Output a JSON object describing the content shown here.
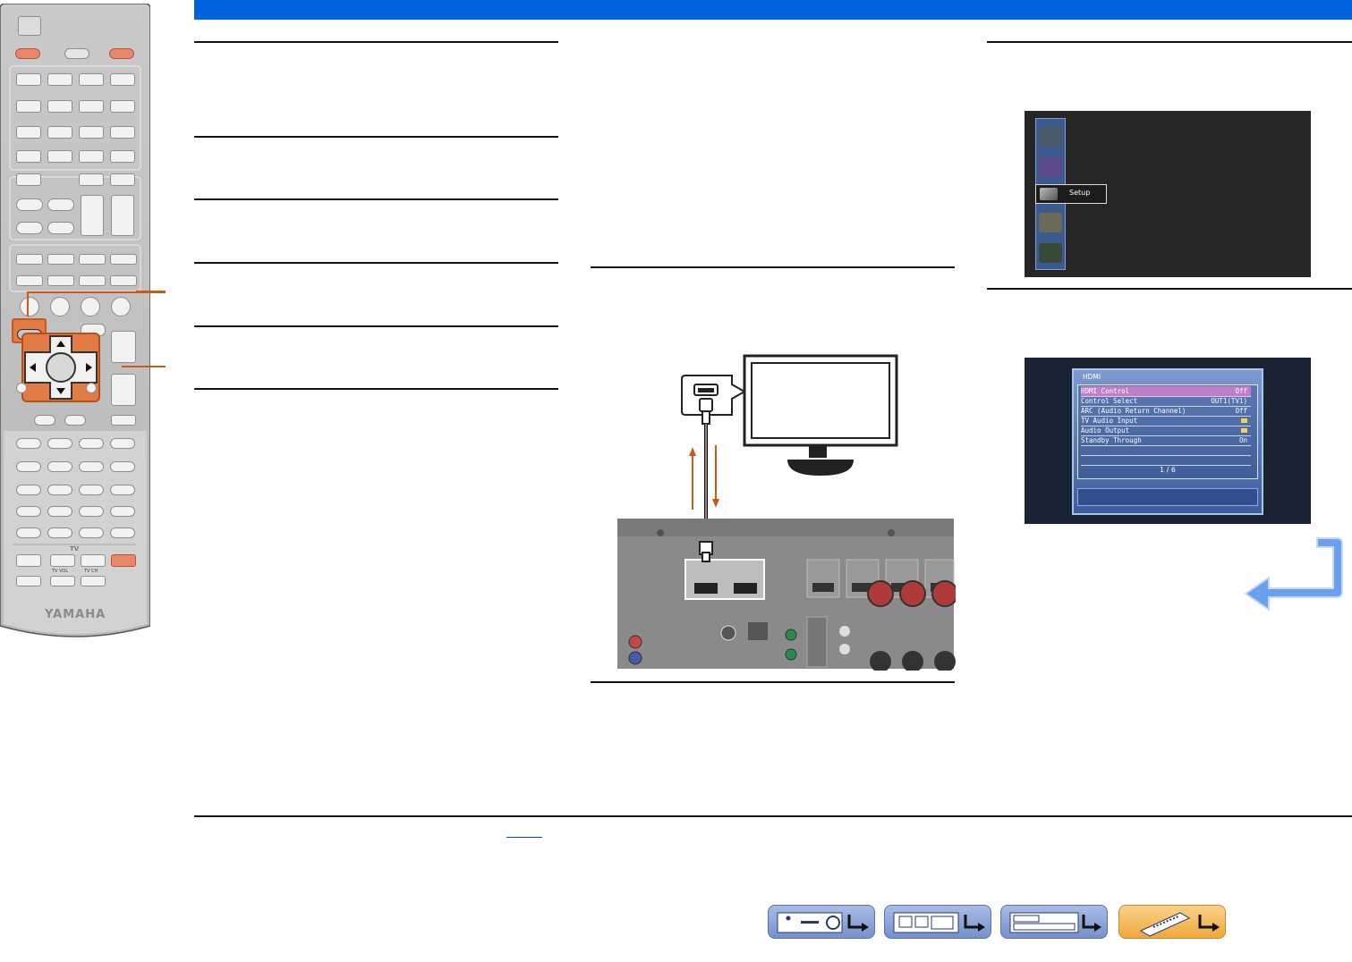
{
  "colors": {
    "header_bar": "#0063dc",
    "rule": "#111111",
    "callout": "#c85a1e",
    "hdmi_highlight": "#c07ec8",
    "nav_receiver": "#8aa2d8",
    "nav_remote": "#f5b84a",
    "return_arrow": "#4f8ee8"
  },
  "remote": {
    "brand": "YAMAHA",
    "tv_label": "TV",
    "tv_vol": "TV VOL",
    "tv_ch": "TV CH"
  },
  "setup_screen": {
    "selected_label": "Setup",
    "icons": [
      "input-icon",
      "scene-icon",
      "setup-icon",
      "option-icon",
      "information-icon"
    ]
  },
  "hdmi_screen": {
    "title": "HDMI",
    "rows": [
      {
        "label": "HDMI Control",
        "value": "Off"
      },
      {
        "label": "Control Select",
        "value": "OUT1(TV1)"
      },
      {
        "label": "ARC (Audio Return Channel)",
        "value": "Off"
      },
      {
        "label": "TV Audio Input",
        "value": "folder-icon"
      },
      {
        "label": "Audio Output",
        "value": "folder-icon"
      },
      {
        "label": "Standby Through",
        "value": "On"
      }
    ],
    "page": "1 / 6"
  },
  "nav_buttons": [
    {
      "name": "receiver-front-icon",
      "arrow": "return-arrow-icon"
    },
    {
      "name": "receiver-rear-icon",
      "arrow": "return-arrow-icon"
    },
    {
      "name": "display-icon",
      "arrow": "return-arrow-icon"
    },
    {
      "name": "remote-control-icon",
      "arrow": "return-arrow-icon"
    }
  ]
}
